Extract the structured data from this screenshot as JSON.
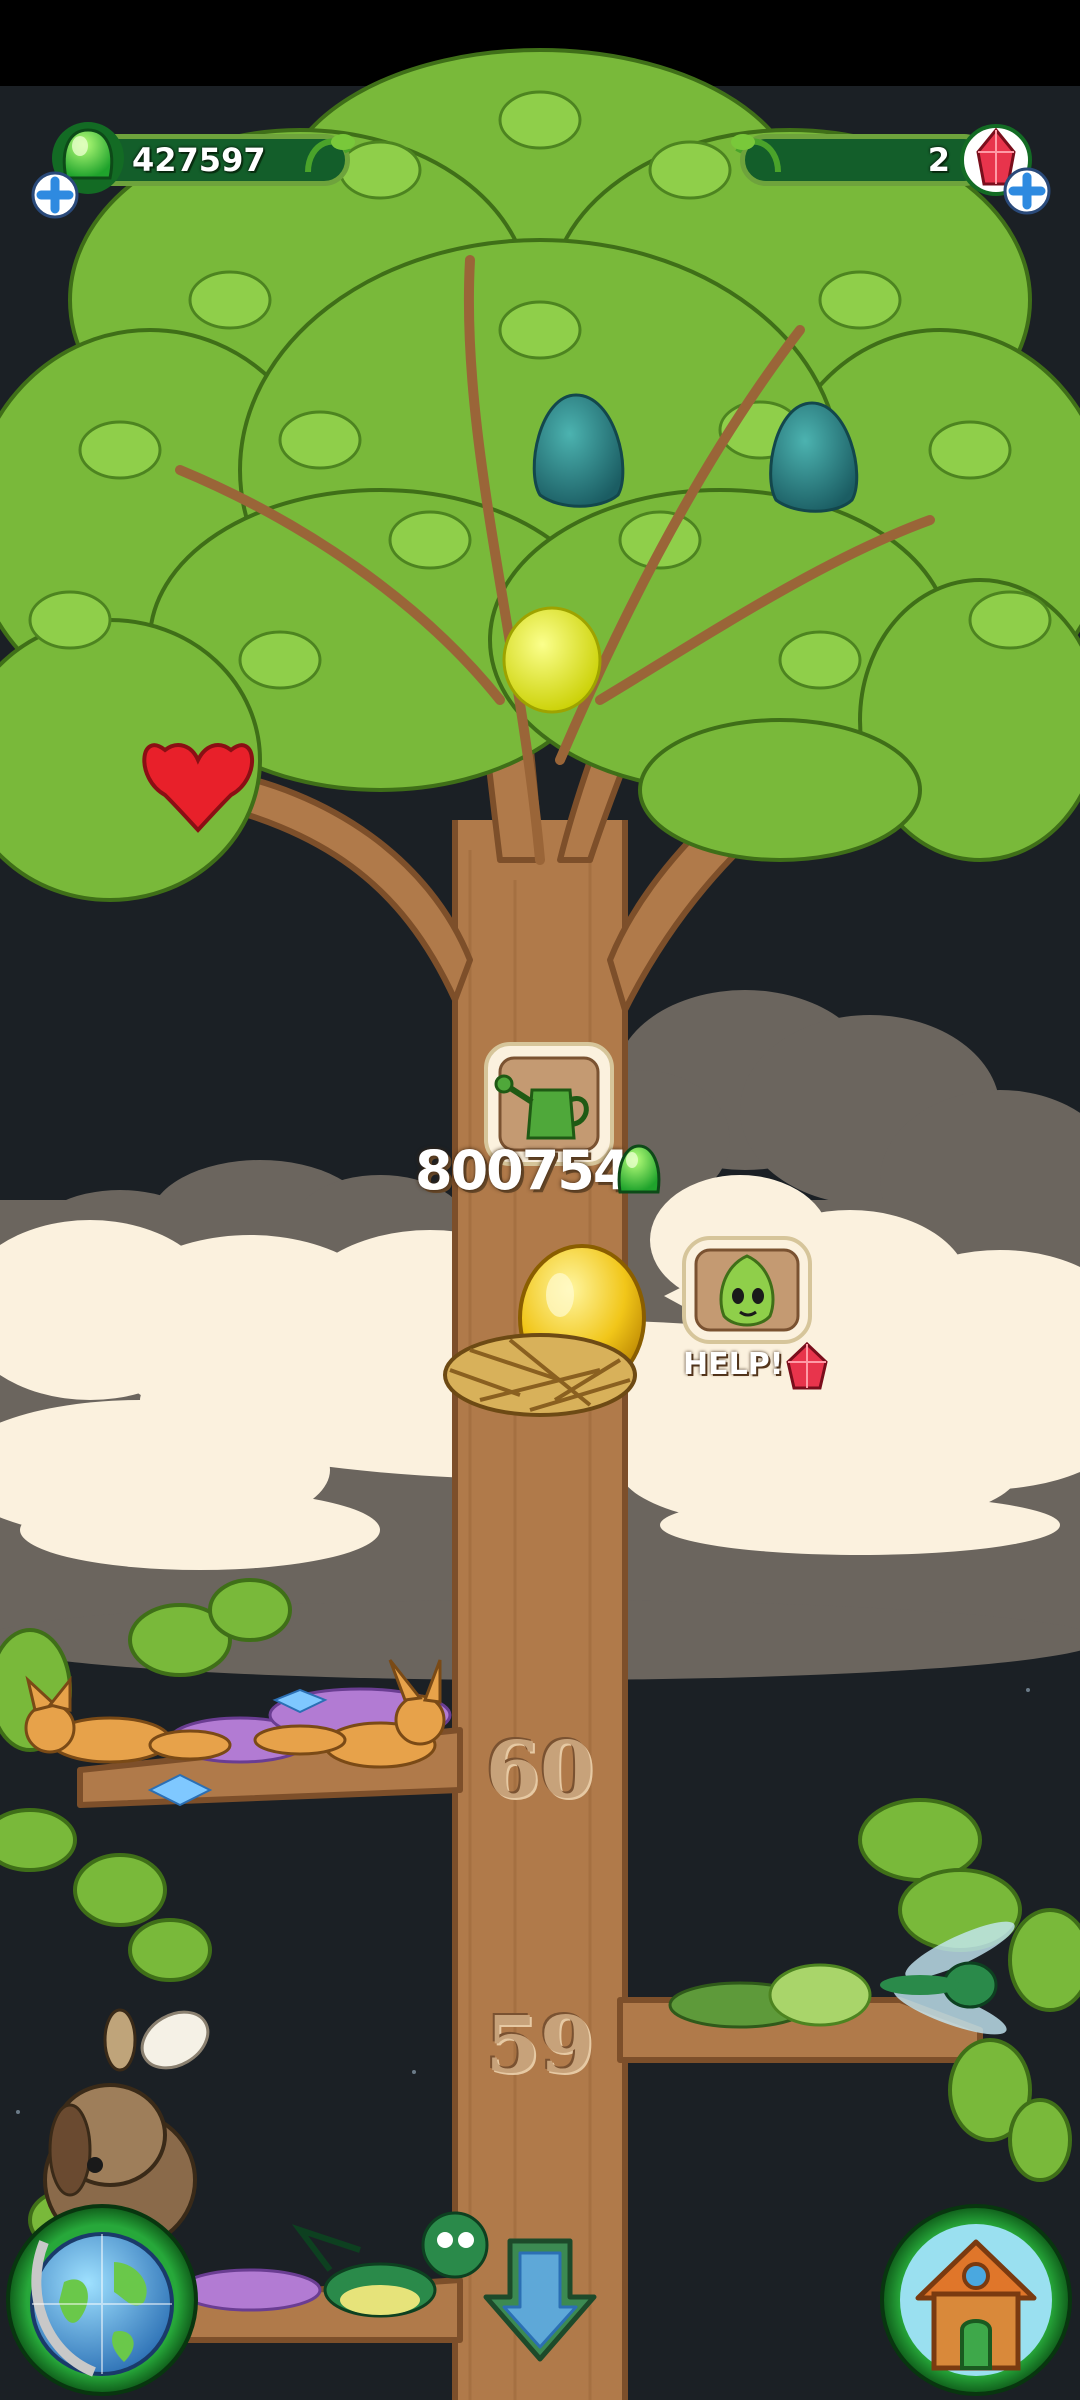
{
  "hud": {
    "gems_count": "427597",
    "crystals_count": "2"
  },
  "tree": {
    "upgrade_cost": "800754",
    "help_label": "HELP!",
    "levels": [
      "60",
      "59"
    ]
  },
  "icons": {
    "gem": "green-gem-icon",
    "crystal": "red-crystal-icon",
    "upgrade": "watering-can-icon",
    "help": "leaf-creature-icon",
    "map": "globe-icon",
    "home": "house-icon",
    "scroll_down": "down-arrow-icon"
  },
  "colors": {
    "sky": "#1a1f22",
    "trunk": "#b07a4a",
    "leaf": "#79b93a",
    "hud_bar": "#135e2a",
    "cloud_light": "#fbf1de",
    "cloud_dark": "#6e6860"
  }
}
